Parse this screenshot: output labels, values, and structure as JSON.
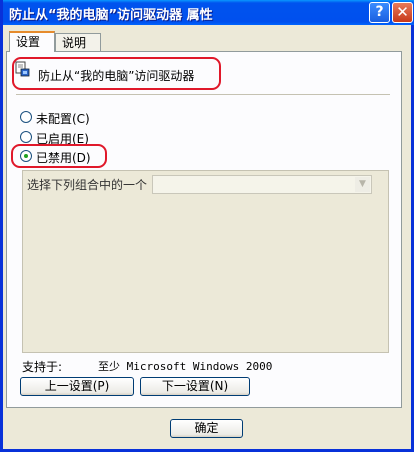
{
  "window": {
    "title": "防止从“我的电脑”访问驱动器 属性",
    "help_glyph": "?",
    "close_glyph": "✕"
  },
  "tabs": [
    {
      "label": "设置",
      "active": true
    },
    {
      "label": "说明",
      "active": false
    }
  ],
  "policy": {
    "title": "防止从“我的电脑”访问驱动器",
    "icon": "policy-setting-icon"
  },
  "radios": [
    {
      "label": "未配置(C)",
      "selected": false
    },
    {
      "label": "已启用(E)",
      "selected": false
    },
    {
      "label": "已禁用(D)",
      "selected": true
    }
  ],
  "options": {
    "combo_label": "选择下列组合中的一个",
    "combo_value": ""
  },
  "supported": {
    "label": "支持于:",
    "value": "至少 Microsoft Windows 2000"
  },
  "buttons": {
    "prev": "上一设置(P)",
    "next": "下一设置(N)",
    "ok": "确定"
  },
  "colors": {
    "titlebar": "#0053EE",
    "highlight": "#E0182A",
    "selected_dot": "#21A121"
  }
}
